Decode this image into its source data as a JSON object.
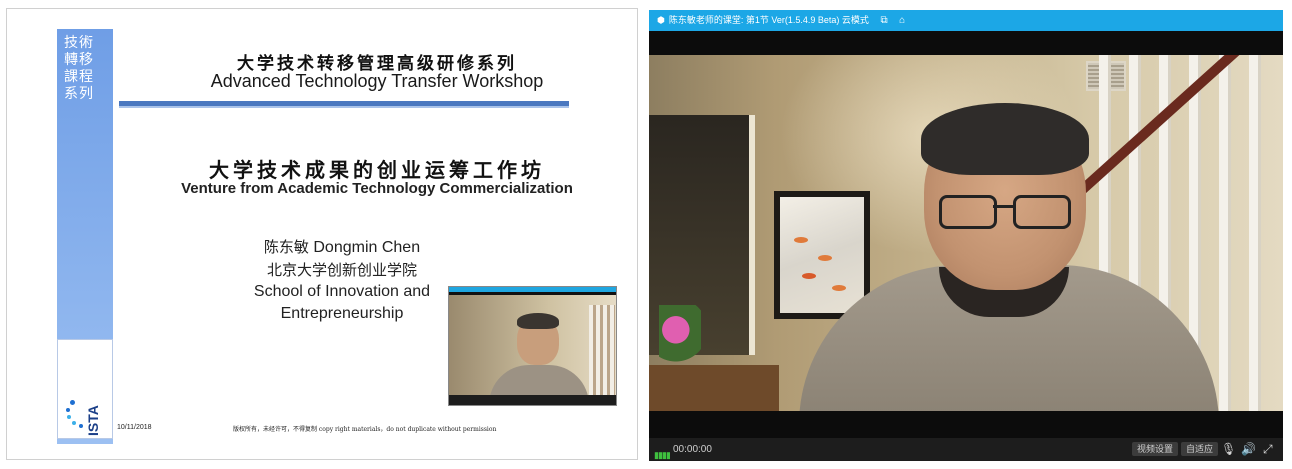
{
  "slide": {
    "side_text": "技術\n轉移\n課程\n系列",
    "title_cn": "大学技术转移管理高级研修系列",
    "title_en": "Advanced Technology Transfer Workshop",
    "subtitle_cn": "大学技术成果的创业运筹工作坊",
    "subtitle_en": "Venture from Academic Technology Commercialization",
    "author_cn": "陈东敏",
    "author_en": "Dongmin Chen",
    "school_cn": "北京大学创新创业学院",
    "school_en_1": "School of Innovation and",
    "school_en_2": "Entrepreneurship",
    "footer_date": "10/11/2018",
    "footer_copyright": "版权所有，未经许可，不得复制 copy right materials，do not duplicate without permission",
    "logo_text": "ISTA"
  },
  "player": {
    "title": "陈东敏老师的课堂: 第1节 Ver(1.5.4.9 Beta) 云模式",
    "time": "00:00:00",
    "video_settings_label": "视频设置",
    "fit_label": "自适应",
    "accent_color": "#1ca7e6"
  },
  "icons": {
    "app": "app-logo-icon",
    "share": "share-icon",
    "home": "home-icon",
    "mic": "microphone-icon",
    "volume": "volume-icon",
    "fullscreen": "fullscreen-icon"
  }
}
